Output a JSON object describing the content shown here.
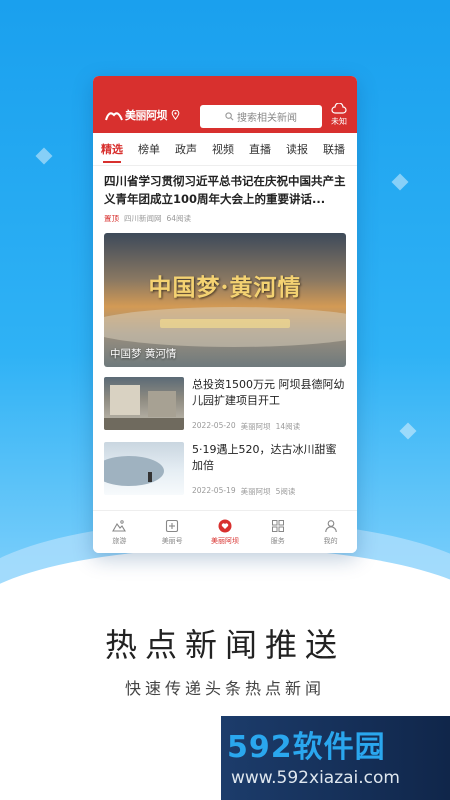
{
  "app": {
    "logo_text": "美丽阿坝",
    "search_placeholder": "搜索相关新闻",
    "weather_text": "未知"
  },
  "tabs": [
    "精选",
    "榜单",
    "政声",
    "视频",
    "直播",
    "读报",
    "联播"
  ],
  "headline": {
    "title": "四川省学习贯彻习近平总书记在庆祝中国共产主义青年团成立100周年大会上的重要讲话...",
    "pin": "置顶",
    "source": "四川新闻网",
    "reads": "64阅读"
  },
  "banner": {
    "art_text": "中国梦·黄河情",
    "caption": "中国梦 黄河情"
  },
  "news": [
    {
      "title": "总投资1500万元 阿坝县德阿幼儿园扩建项目开工",
      "date": "2022-05-20",
      "source": "美丽阿坝",
      "reads": "14阅读"
    },
    {
      "title": "5·19遇上520，达古冰川甜蜜加倍",
      "date": "2022-05-19",
      "source": "美丽阿坝",
      "reads": "5阅读"
    }
  ],
  "bottom_nav": [
    {
      "label": "旅游",
      "icon": "mountain-icon"
    },
    {
      "label": "美丽号",
      "icon": "plus-box-icon"
    },
    {
      "label": "美丽阿坝",
      "icon": "heart-icon"
    },
    {
      "label": "服务",
      "icon": "grid-icon"
    },
    {
      "label": "我的",
      "icon": "user-icon"
    }
  ],
  "promo": {
    "title": "热点新闻推送",
    "subtitle": "快速传递头条热点新闻"
  },
  "watermark": {
    "brand": "592软件园",
    "url": "www.592xiazai.com"
  },
  "colors": {
    "brand_red": "#d8302e",
    "sky_blue": "#1aa0ee"
  }
}
